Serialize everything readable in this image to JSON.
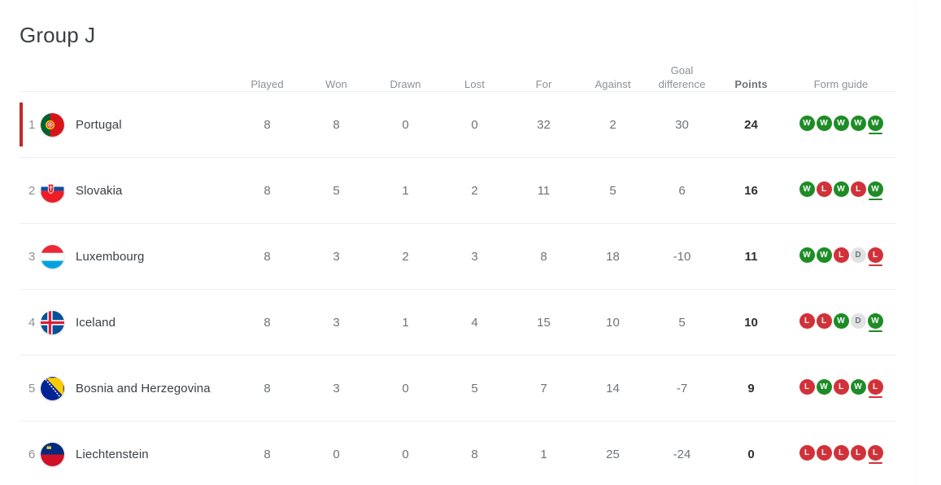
{
  "page_title": "Group J",
  "colors": {
    "win": "#1e8c26",
    "loss": "#d13239",
    "draw": "#e0e2e4",
    "qualification_marker": "#c62828",
    "title_text": "#3b4045",
    "header_text": "#8d9094"
  },
  "table": {
    "headers": {
      "team": "",
      "played": "Played",
      "won": "Won",
      "drawn": "Drawn",
      "lost": "Lost",
      "for": "For",
      "against": "Against",
      "goal_difference_line1": "Goal",
      "goal_difference_line2": "difference",
      "points": "Points",
      "form_guide": "Form guide"
    },
    "rows": [
      {
        "rank": "1",
        "team": "Portugal",
        "flag": "portugal-flag-icon",
        "qualified": true,
        "played": "8",
        "won": "8",
        "drawn": "0",
        "lost": "0",
        "for": "32",
        "against": "2",
        "goal_difference": "30",
        "points": "24",
        "form": [
          "W",
          "W",
          "W",
          "W",
          "W"
        ],
        "form_latest_index": 4
      },
      {
        "rank": "2",
        "team": "Slovakia",
        "flag": "slovakia-flag-icon",
        "qualified": false,
        "played": "8",
        "won": "5",
        "drawn": "1",
        "lost": "2",
        "for": "11",
        "against": "5",
        "goal_difference": "6",
        "points": "16",
        "form": [
          "W",
          "L",
          "W",
          "L",
          "W"
        ],
        "form_latest_index": 4
      },
      {
        "rank": "3",
        "team": "Luxembourg",
        "flag": "luxembourg-flag-icon",
        "qualified": false,
        "played": "8",
        "won": "3",
        "drawn": "2",
        "lost": "3",
        "for": "8",
        "against": "18",
        "goal_difference": "-10",
        "points": "11",
        "form": [
          "W",
          "W",
          "L",
          "D",
          "L"
        ],
        "form_latest_index": 4
      },
      {
        "rank": "4",
        "team": "Iceland",
        "flag": "iceland-flag-icon",
        "qualified": false,
        "played": "8",
        "won": "3",
        "drawn": "1",
        "lost": "4",
        "for": "15",
        "against": "10",
        "goal_difference": "5",
        "points": "10",
        "form": [
          "L",
          "L",
          "W",
          "D",
          "W"
        ],
        "form_latest_index": 4
      },
      {
        "rank": "5",
        "team": "Bosnia and Herzegovina",
        "flag": "bosnia-and-herzegovina-flag-icon",
        "qualified": false,
        "played": "8",
        "won": "3",
        "drawn": "0",
        "lost": "5",
        "for": "7",
        "against": "14",
        "goal_difference": "-7",
        "points": "9",
        "form": [
          "L",
          "W",
          "L",
          "W",
          "L"
        ],
        "form_latest_index": 4
      },
      {
        "rank": "6",
        "team": "Liechtenstein",
        "flag": "liechtenstein-flag-icon",
        "qualified": false,
        "played": "8",
        "won": "0",
        "drawn": "0",
        "lost": "8",
        "for": "1",
        "against": "25",
        "goal_difference": "-24",
        "points": "0",
        "form": [
          "L",
          "L",
          "L",
          "L",
          "L"
        ],
        "form_latest_index": 4
      }
    ]
  }
}
